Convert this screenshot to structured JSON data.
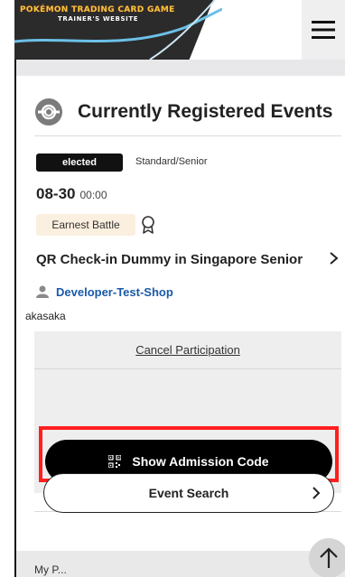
{
  "header": {
    "logo_line1": "POKÉMON TRADING CARD GAME",
    "logo_line2": "TRAINER'S WEBSITE",
    "search_icon": "search-icon",
    "user_icon": "user-icon",
    "menu_icon": "hamburger-menu-icon"
  },
  "section": {
    "title": "Currently Registered Events",
    "icon": "registered-events-icon"
  },
  "event": {
    "status": "elected",
    "category": "Standard/Senior",
    "date": "08-30",
    "time": "00:00",
    "battle_type": "Earnest Battle",
    "battle_icon": "ribbon-icon",
    "name": "QR Check-in Dummy in Singapore Senior",
    "shop": "Developer-Test-Shop",
    "location": "akasaka"
  },
  "actions": {
    "cancel_label": "Cancel Participation",
    "admission_label": "Show Admission Code",
    "admission_icon": "qr-code-icon"
  },
  "event_search": {
    "label": "Event Search"
  },
  "footer": {
    "partial_label": "My P..."
  },
  "colors": {
    "highlight": "#ff1f1f",
    "link": "#1a5aa8",
    "badge_bg": "#111111",
    "tag_bg": "#fbefdf",
    "panel_bg": "#eeeeef"
  }
}
